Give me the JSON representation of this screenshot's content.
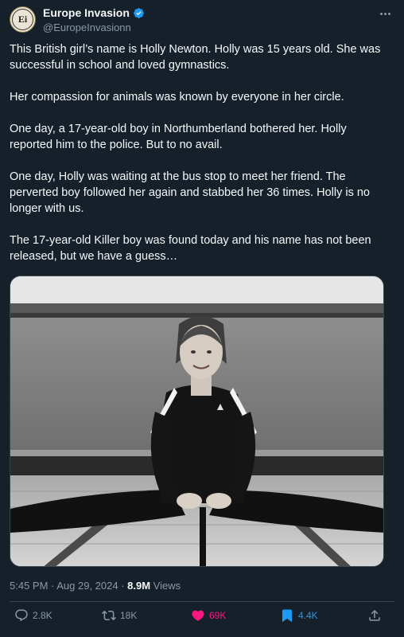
{
  "author": {
    "avatar_text": "Ei",
    "display_name": "Europe Invasion",
    "handle": "@EuropeInvasionn",
    "verified_icon": "verified-badge-icon"
  },
  "tweet": {
    "paragraphs": [
      "This British girl’s name is Holly Newton. Holly was 15 years old. She was successful in school and loved gymnastics.",
      "Her compassion for animals was known by everyone in her circle.",
      "One day, a 17-year-old boy in Northumberland bothered her. Holly reported him to the police. But to no avail.",
      "One day, Holly was waiting at the bus stop to meet her friend. The perverted boy followed her again and stabbed her 36 times. Holly is no longer with us.",
      "The 17-year-old Killer boy was found today and his name has not been released, but we have a guess…"
    ]
  },
  "meta": {
    "timestamp": "5:45 PM · Aug 29, 2024 · ",
    "views_count": "8.9M",
    "views_label": " Views"
  },
  "actions": {
    "replies": "2.8K",
    "reposts": "18K",
    "likes": "69K",
    "bookmarks": "4.4K"
  },
  "colors": {
    "background": "#15202b",
    "like": "#f91880",
    "bookmark": "#1d9bf0",
    "muted": "#8b98a5"
  }
}
